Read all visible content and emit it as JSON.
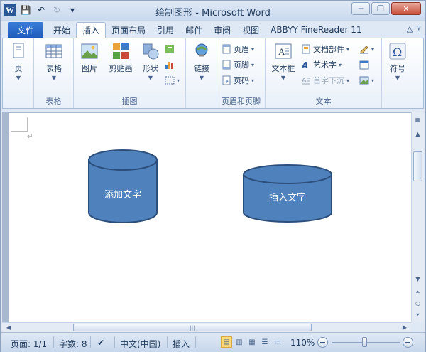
{
  "window": {
    "title": "绘制图形 - Microsoft Word",
    "app_logo": "W"
  },
  "qat": {
    "save": "💾",
    "undo": "↶",
    "redo": "↻",
    "customize": "▾"
  },
  "tabs": {
    "file": "文件",
    "items": [
      "开始",
      "插入",
      "页面布局",
      "引用",
      "邮件",
      "审阅",
      "视图",
      "ABBYY FineReader 11"
    ],
    "active_index": 1,
    "help": "?"
  },
  "ribbon": {
    "pages": {
      "label": "页",
      "group": ""
    },
    "table": {
      "label": "表格",
      "group": "表格"
    },
    "illustrations": {
      "group": "插图",
      "picture": "图片",
      "clipart": "剪贴画",
      "shapes": "形状"
    },
    "links": {
      "label": "链接",
      "group": ""
    },
    "header_footer": {
      "group": "页眉和页脚",
      "header": "页眉",
      "footer": "页脚",
      "page_number": "页码"
    },
    "text": {
      "group": "文本",
      "textbox": "文本框",
      "quickparts": "文档部件",
      "wordart": "艺术字",
      "dropcap": "首字下沉"
    },
    "symbols": {
      "label": "符号",
      "group": ""
    }
  },
  "document": {
    "para_mark": "↵",
    "shapes": [
      {
        "label": "添加文字"
      },
      {
        "label": "插入文字"
      }
    ]
  },
  "statusbar": {
    "page": "页面: 1/1",
    "words": "字数: 8",
    "language": "中文(中国)",
    "mode": "插入",
    "zoom": "110%",
    "zoom_level_percent": 110
  },
  "colors": {
    "shape_fill": "#4f81bd",
    "shape_stroke": "#2c4e7a",
    "accent": "#2b5797"
  }
}
